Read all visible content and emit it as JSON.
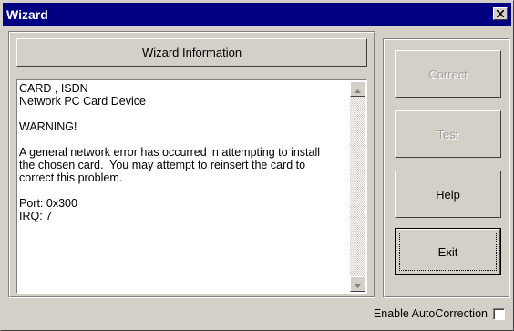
{
  "window": {
    "title": "Wizard"
  },
  "header": {
    "label": "Wizard Information"
  },
  "message": {
    "lines": [
      "CARD , ISDN",
      "Network PC Card Device",
      "",
      "WARNING!",
      "",
      "A general network error has occurred in attempting to install",
      "the chosen card.  You may attempt to reinsert the card to",
      "correct this problem.",
      "",
      "Port: 0x300",
      "IRQ: 7"
    ]
  },
  "buttons": {
    "correct": "Correct",
    "test": "Test",
    "help": "Help",
    "exit": "Exit"
  },
  "options": {
    "autocorrection_label": "Enable AutoCorrection",
    "autocorrection_checked": false
  },
  "colors": {
    "titlebar": "#000080",
    "face": "#d4d0c8"
  }
}
